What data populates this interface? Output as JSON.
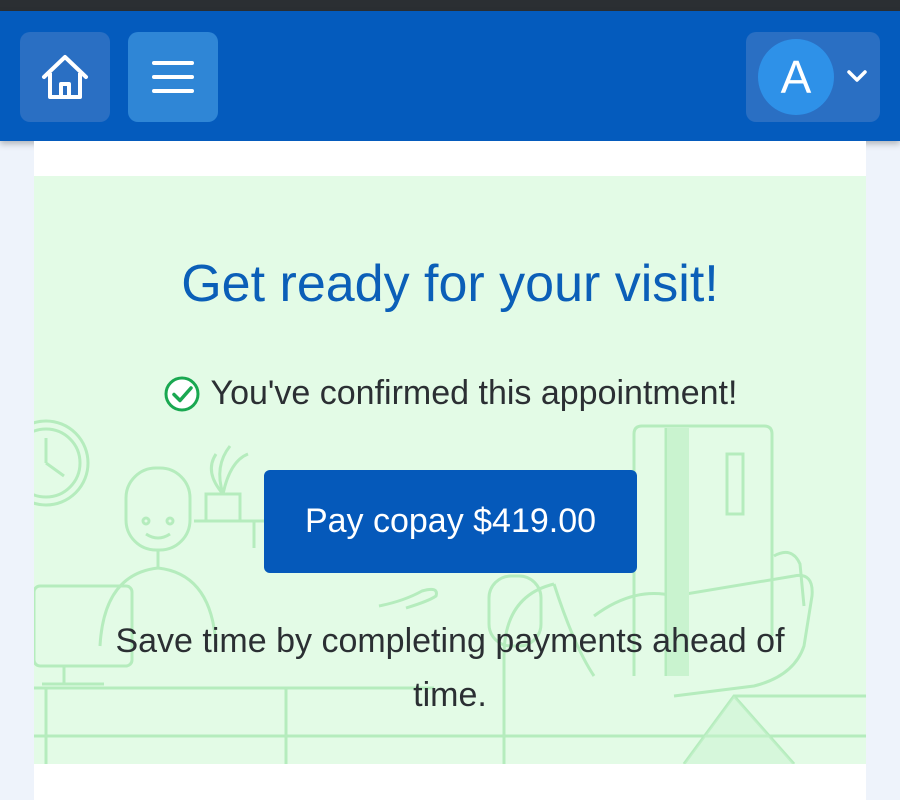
{
  "header": {
    "home_icon": "home-icon",
    "menu_icon": "hamburger-menu-icon",
    "account": {
      "avatar_initial": "A",
      "dropdown_icon": "chevron-down-icon"
    }
  },
  "visit_card": {
    "title": "Get ready for your visit!",
    "confirmation": {
      "icon": "check-circle-icon",
      "text": "You've confirmed this appointment!"
    },
    "pay_button_label": "Pay copay $419.00",
    "info_text": "Save time by completing payments ahead of time."
  },
  "colors": {
    "header_bg": "#045bbd",
    "accent_blue": "#0b5fb8",
    "button_bg": "#0559ba",
    "hero_bg": "#e3fbe6",
    "check_green": "#1aa851"
  }
}
